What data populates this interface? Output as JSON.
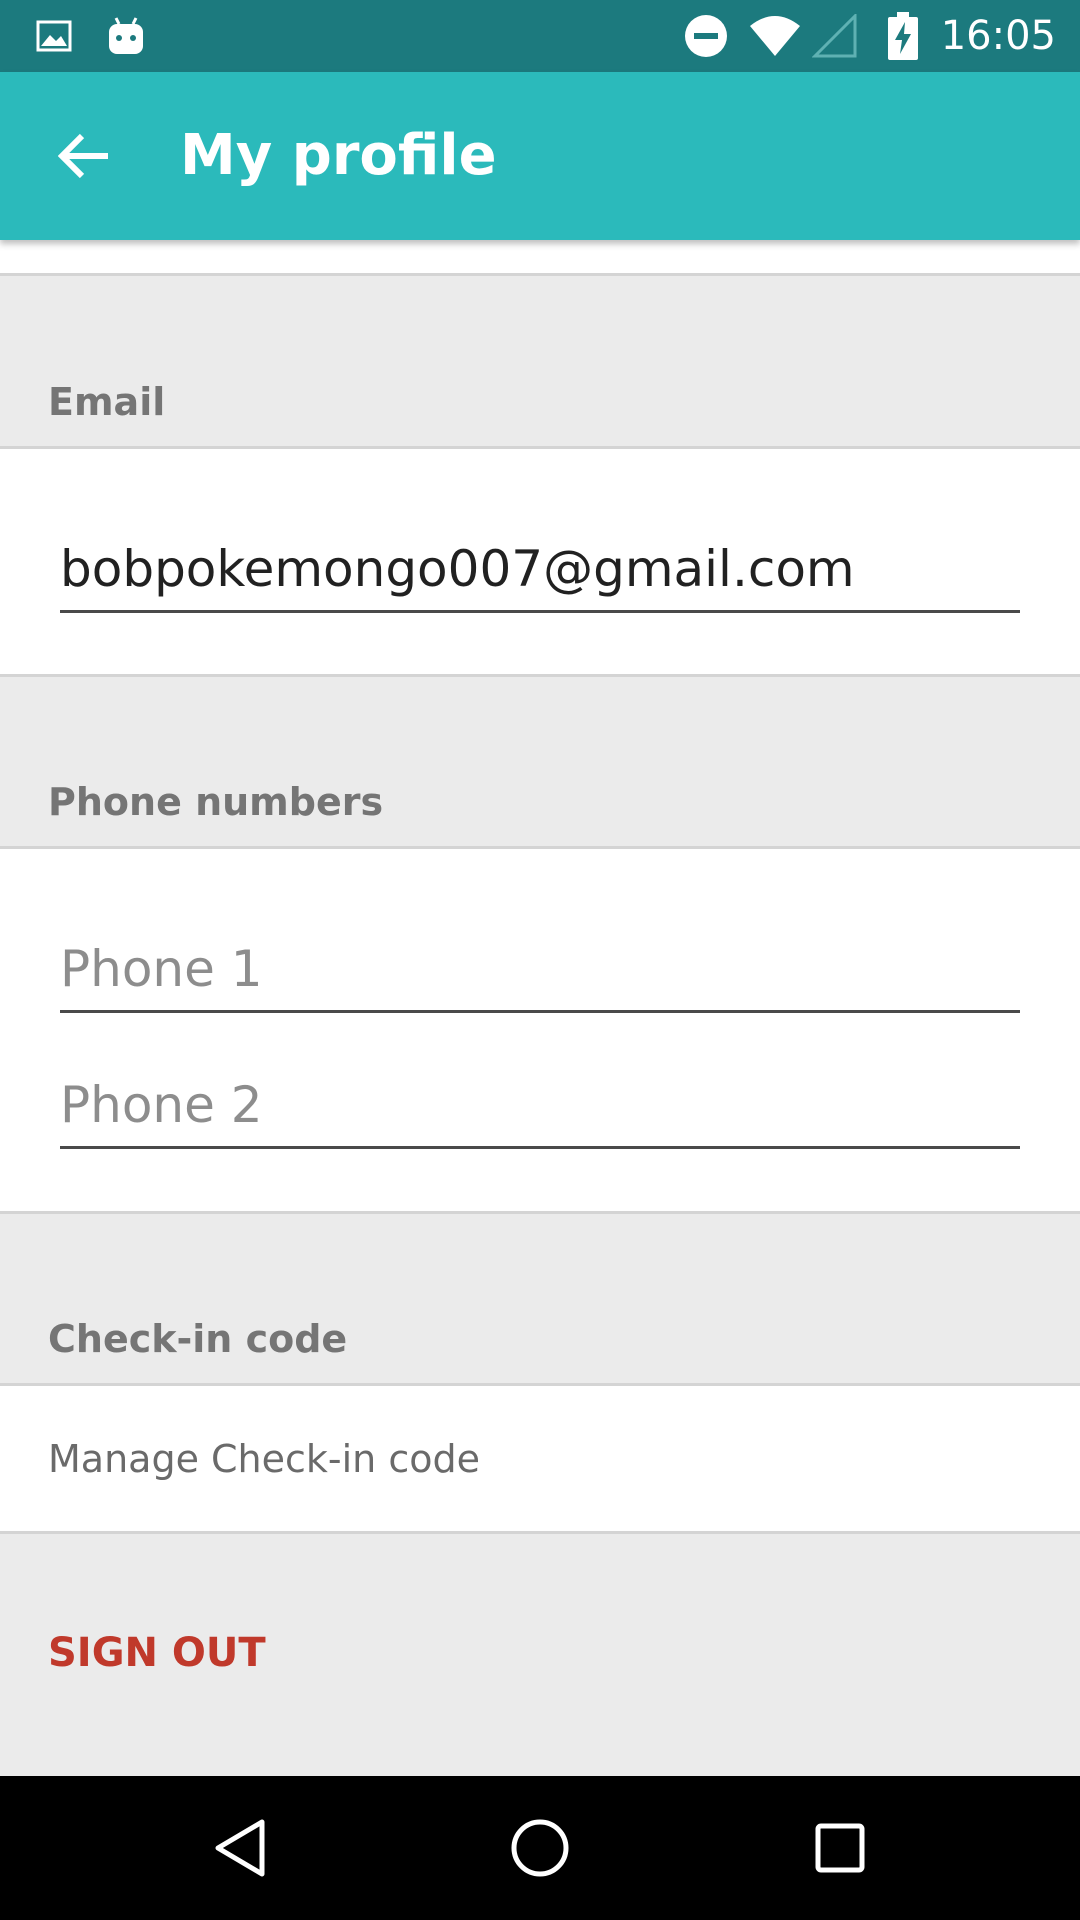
{
  "status_bar": {
    "time": "16:05",
    "icons": [
      "image-icon",
      "android-icon",
      "do-not-disturb-icon",
      "wifi-icon",
      "signal-icon",
      "battery-charging-icon"
    ],
    "background": "#1c7a7e"
  },
  "app_bar": {
    "title": "My profile",
    "back_icon": "arrow-back-icon",
    "background": "#2bbabb"
  },
  "email_section": {
    "header": "Email",
    "email_value": "bobpokemongo007@gmail.com"
  },
  "phone_section": {
    "header": "Phone numbers",
    "phone1_placeholder": "Phone 1",
    "phone2_placeholder": "Phone 2"
  },
  "checkin_section": {
    "header": "Check-in code",
    "manage_label": "Manage Check-in code"
  },
  "sign_out": {
    "label": "SIGN OUT",
    "color": "#c0392b"
  },
  "nav_bar": {
    "buttons": [
      "back-triangle-icon",
      "home-circle-icon",
      "recents-square-icon"
    ]
  }
}
